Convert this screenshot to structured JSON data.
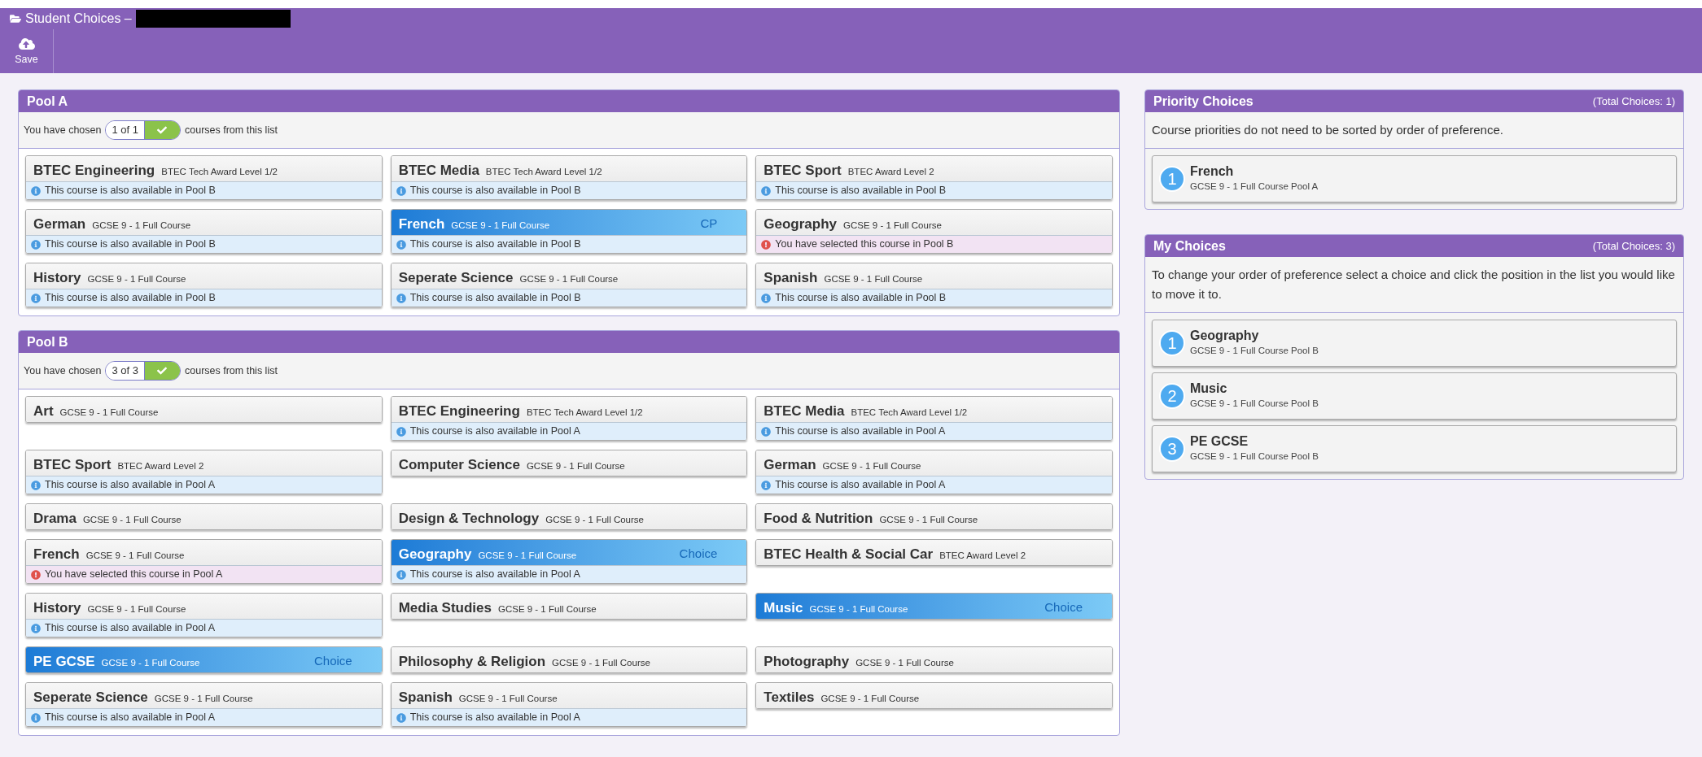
{
  "window": {
    "title": "Student Choices –",
    "redacted": true
  },
  "toolbar": [
    {
      "label": "Save"
    }
  ],
  "pools": [
    {
      "title": "Pool A",
      "chosen_prefix": "You have chosen",
      "count": "1 of 1",
      "complete": true,
      "chosen_suffix": "courses from this list",
      "courses": [
        {
          "name": "BTEC Engineering",
          "subtitle": "BTEC Tech Award Level 1/2",
          "selected": false,
          "note": {
            "kind": "info",
            "text": "This course is also available in Pool B"
          }
        },
        {
          "name": "BTEC Media",
          "subtitle": "BTEC Tech Award Level 1/2",
          "selected": false,
          "note": {
            "kind": "info",
            "text": "This course is also available in Pool B"
          }
        },
        {
          "name": "BTEC Sport",
          "subtitle": "BTEC Award Level 2",
          "selected": false,
          "note": {
            "kind": "info",
            "text": "This course is also available in Pool B"
          }
        },
        {
          "name": "German",
          "subtitle": "GCSE 9 - 1 Full Course",
          "selected": false,
          "note": {
            "kind": "info",
            "text": "This course is also available in Pool B"
          }
        },
        {
          "name": "French",
          "subtitle": "GCSE 9 - 1 Full Course",
          "selected": true,
          "tag": "CP",
          "note": {
            "kind": "info",
            "text": "This course is also available in Pool B"
          }
        },
        {
          "name": "Geography",
          "subtitle": "GCSE 9 - 1 Full Course",
          "selected": false,
          "note": {
            "kind": "warning",
            "text": "You have selected this course in Pool B"
          }
        },
        {
          "name": "History",
          "subtitle": "GCSE 9 - 1 Full Course",
          "selected": false,
          "note": {
            "kind": "info",
            "text": "This course is also available in Pool B"
          }
        },
        {
          "name": "Seperate Science",
          "subtitle": "GCSE 9 - 1 Full Course",
          "selected": false,
          "note": {
            "kind": "info",
            "text": "This course is also available in Pool B"
          }
        },
        {
          "name": "Spanish",
          "subtitle": "GCSE 9 - 1 Full Course",
          "selected": false,
          "note": {
            "kind": "info",
            "text": "This course is also available in Pool B"
          }
        }
      ]
    },
    {
      "title": "Pool B",
      "chosen_prefix": "You have chosen",
      "count": "3 of 3",
      "complete": true,
      "chosen_suffix": "courses from this list",
      "courses": [
        {
          "name": "Art",
          "subtitle": "GCSE 9 - 1 Full Course",
          "selected": false
        },
        {
          "name": "BTEC Engineering",
          "subtitle": "BTEC Tech Award Level 1/2",
          "selected": false,
          "note": {
            "kind": "info",
            "text": "This course is also available in Pool A"
          }
        },
        {
          "name": "BTEC Media",
          "subtitle": "BTEC Tech Award Level 1/2",
          "selected": false,
          "note": {
            "kind": "info",
            "text": "This course is also available in Pool A"
          }
        },
        {
          "name": "BTEC Sport",
          "subtitle": "BTEC Award Level 2",
          "selected": false,
          "note": {
            "kind": "info",
            "text": "This course is also available in Pool A"
          }
        },
        {
          "name": "Computer Science",
          "subtitle": "GCSE 9 - 1 Full Course",
          "selected": false
        },
        {
          "name": "German",
          "subtitle": "GCSE 9 - 1 Full Course",
          "selected": false,
          "note": {
            "kind": "info",
            "text": "This course is also available in Pool A"
          }
        },
        {
          "name": "Drama",
          "subtitle": "GCSE 9 - 1 Full Course",
          "selected": false
        },
        {
          "name": "Design & Technology",
          "subtitle": "GCSE 9 - 1 Full Course",
          "selected": false
        },
        {
          "name": "Food & Nutrition",
          "subtitle": "GCSE 9 - 1 Full Course",
          "selected": false
        },
        {
          "name": "French",
          "subtitle": "GCSE 9 - 1 Full Course",
          "selected": false,
          "note": {
            "kind": "warning",
            "text": "You have selected this course in Pool A"
          }
        },
        {
          "name": "Geography",
          "subtitle": "GCSE 9 - 1 Full Course",
          "selected": true,
          "tag": "Choice",
          "note": {
            "kind": "info",
            "text": "This course is also available in Pool A"
          }
        },
        {
          "name": "BTEC Health & Social Car",
          "subtitle": "BTEC Award Level 2",
          "selected": false
        },
        {
          "name": "History",
          "subtitle": "GCSE 9 - 1 Full Course",
          "selected": false,
          "note": {
            "kind": "info",
            "text": "This course is also available in Pool A"
          }
        },
        {
          "name": "Media Studies",
          "subtitle": "GCSE 9 - 1 Full Course",
          "selected": false
        },
        {
          "name": "Music",
          "subtitle": "GCSE 9 - 1 Full Course",
          "selected": true,
          "tag": "Choice"
        },
        {
          "name": "PE GCSE",
          "subtitle": "GCSE 9 - 1 Full Course",
          "selected": true,
          "tag": "Choice"
        },
        {
          "name": "Philosophy & Religion",
          "subtitle": "GCSE 9 - 1 Full Course",
          "selected": false
        },
        {
          "name": "Photography",
          "subtitle": "GCSE 9 - 1 Full Course",
          "selected": false
        },
        {
          "name": "Seperate Science",
          "subtitle": "GCSE 9 - 1 Full Course",
          "selected": false,
          "note": {
            "kind": "info",
            "text": "This course is also available in Pool A"
          }
        },
        {
          "name": "Spanish",
          "subtitle": "GCSE 9 - 1 Full Course",
          "selected": false,
          "note": {
            "kind": "info",
            "text": "This course is also available in Pool A"
          }
        },
        {
          "name": "Textiles",
          "subtitle": "GCSE 9 - 1 Full Course",
          "selected": false
        }
      ]
    }
  ],
  "side_panels": [
    {
      "title": "Priority Choices",
      "total": "(Total Choices: 1)",
      "description": "Course priorities do not need to be sorted by order of preference.",
      "items": [
        {
          "number": "1",
          "name": "French",
          "detail": "GCSE 9 - 1 Full Course Pool A"
        }
      ]
    },
    {
      "title": "My Choices",
      "total": "(Total Choices: 3)",
      "description": "To change your order of preference select a choice and click the position in the list you would like to move it to.",
      "items": [
        {
          "number": "1",
          "name": "Geography",
          "detail": "GCSE 9 - 1 Full Course Pool B"
        },
        {
          "number": "2",
          "name": "Music",
          "detail": "GCSE 9 - 1 Full Course Pool B"
        },
        {
          "number": "3",
          "name": "PE GCSE",
          "detail": "GCSE 9 - 1 Full Course Pool B"
        }
      ]
    }
  ]
}
